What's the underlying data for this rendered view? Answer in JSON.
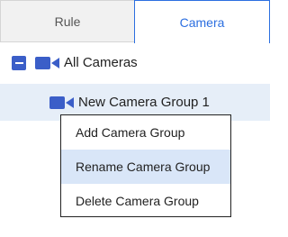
{
  "tabs": [
    {
      "label": "Rule",
      "active": false
    },
    {
      "label": "Camera",
      "active": true
    }
  ],
  "tree": {
    "root": {
      "label": "All Cameras",
      "expanded": true,
      "icon": "camera-icon"
    },
    "children": [
      {
        "label": "New Camera Group 1",
        "selected": true,
        "icon": "camera-icon"
      }
    ]
  },
  "context_menu": {
    "items": [
      {
        "label": "Add Camera Group"
      },
      {
        "label": "Rename Camera Group",
        "highlighted": true
      },
      {
        "label": "Delete Camera Group"
      }
    ]
  },
  "colors": {
    "accent": "#2c6fe0",
    "icon": "#3b5ec8",
    "selection": "#e6eef8",
    "menu_highlight": "#d9e6f8"
  }
}
